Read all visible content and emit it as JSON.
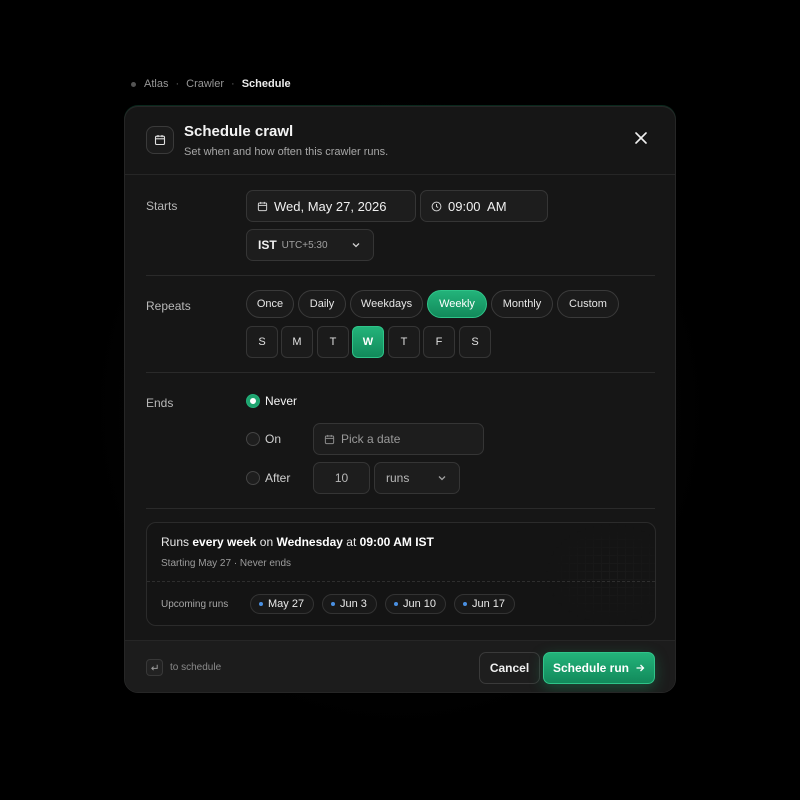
{
  "colors": {
    "accent": "#1ea46f",
    "accent_light": "#23b37a",
    "bullet": "#4a90e2",
    "background": "#000000",
    "surface": "#161616"
  },
  "breadcrumb": {
    "items": [
      "Atlas",
      "Crawler"
    ],
    "current": "Schedule",
    "separator": "·"
  },
  "dialog": {
    "title": "Schedule crawl",
    "subtitle": "Set when and how often this crawler runs.",
    "icon": "calendar-icon",
    "close_icon": "close-icon"
  },
  "starts": {
    "label": "Starts",
    "date": "Wed, May 27, 2026",
    "time": "09:00  AM",
    "timezone": "IST",
    "timezone_offset": "UTC+5:30"
  },
  "repeats": {
    "label": "Repeats",
    "options": [
      "Once",
      "Daily",
      "Weekdays",
      "Weekly",
      "Monthly",
      "Custom"
    ],
    "selected": "Weekly",
    "days": [
      "S",
      "M",
      "T",
      "W",
      "T",
      "F",
      "S"
    ],
    "selected_day_index": 3
  },
  "ends": {
    "label": "Ends",
    "never_label": "Never",
    "on_label": "On",
    "on_placeholder": "Pick a date",
    "after_label": "After",
    "after_count": "10",
    "after_unit": "runs",
    "selected": "Never"
  },
  "summary": {
    "line_prefix": "Runs",
    "line_freq": "every week",
    "line_on": "on",
    "line_day": "Wednesday",
    "line_at": "at",
    "line_time": "09:00 AM IST",
    "sub": "Starting May 27 · Never ends",
    "upcoming_label": "Upcoming runs",
    "upcoming": [
      "May 27",
      "Jun 3",
      "Jun 10",
      "Jun 17"
    ]
  },
  "footer": {
    "hint": "to schedule",
    "cancel_label": "Cancel",
    "primary_label": "Schedule run"
  }
}
